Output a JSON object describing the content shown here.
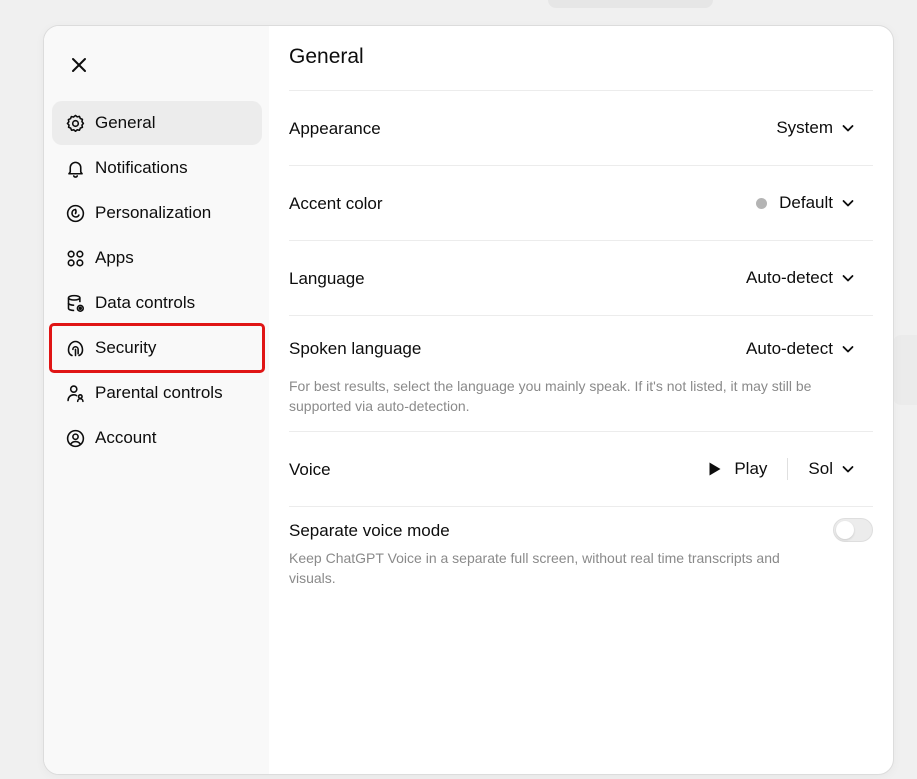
{
  "sidebar": {
    "items": [
      {
        "label": "General",
        "icon": "gear-icon",
        "active": true
      },
      {
        "label": "Notifications",
        "icon": "bell-icon"
      },
      {
        "label": "Personalization",
        "icon": "personalization-icon"
      },
      {
        "label": "Apps",
        "icon": "apps-grid-icon"
      },
      {
        "label": "Data controls",
        "icon": "database-icon"
      },
      {
        "label": "Security",
        "icon": "security-icon",
        "highlighted": true
      },
      {
        "label": "Parental controls",
        "icon": "parental-icon"
      },
      {
        "label": "Account",
        "icon": "account-icon"
      }
    ]
  },
  "main": {
    "title": "General",
    "appearance": {
      "label": "Appearance",
      "value": "System"
    },
    "accent_color": {
      "label": "Accent color",
      "value": "Default",
      "swatch": "#b4b4b4"
    },
    "language": {
      "label": "Language",
      "value": "Auto-detect"
    },
    "spoken_language": {
      "label": "Spoken language",
      "value": "Auto-detect",
      "description": "For best results, select the language you mainly speak. If it's not listed, it may still be supported via auto-detection."
    },
    "voice": {
      "label": "Voice",
      "play_label": "Play",
      "value": "Sol"
    },
    "separate_voice_mode": {
      "label": "Separate voice mode",
      "description": "Keep ChatGPT Voice in a separate full screen, without real time transcripts and visuals.",
      "enabled": false
    }
  },
  "colors": {
    "highlight": "#e01515",
    "active_bg": "#ececec",
    "muted_text": "#8a8a8a"
  }
}
